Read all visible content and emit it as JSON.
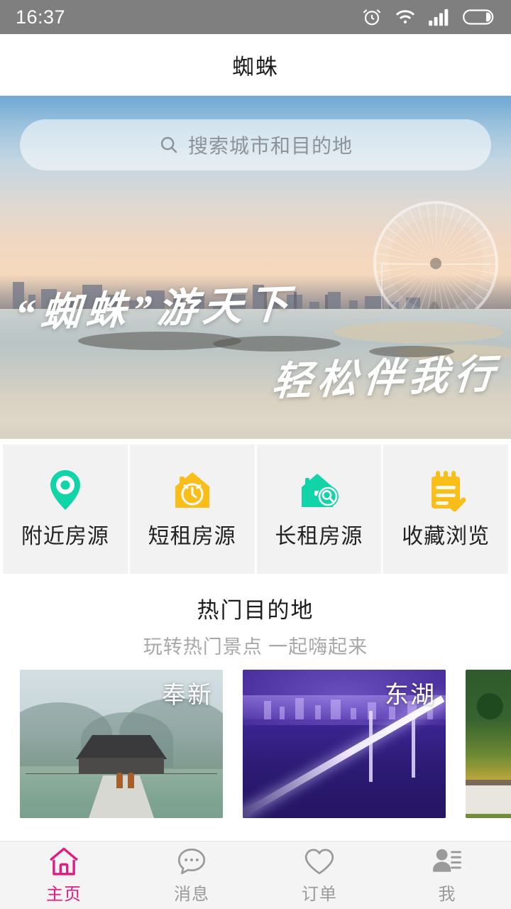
{
  "status_bar": {
    "time": "16:37",
    "icons": [
      "alarm-clock-icon",
      "wifi-icon",
      "signal-icon",
      "battery-icon"
    ]
  },
  "header": {
    "title": "蜘蛛"
  },
  "hero": {
    "search": {
      "placeholder": "搜索城市和目的地",
      "icon": "search-icon"
    },
    "slogan_line1": "“蜘蛛”游天下",
    "slogan_line2": "轻松伴我行"
  },
  "quick_actions": [
    {
      "label": "附近房源",
      "icon": "location-pin-icon",
      "color": "#11d4a8"
    },
    {
      "label": "短租房源",
      "icon": "house-clock-icon",
      "color": "#fbbe18"
    },
    {
      "label": "长租房源",
      "icon": "house-search-icon",
      "color": "#11d4a8"
    },
    {
      "label": "收藏浏览",
      "icon": "notepad-check-icon",
      "color": "#fbbe18"
    }
  ],
  "section": {
    "title": "热门目的地",
    "subtitle": "玩转热门景点 一起嗨起来"
  },
  "destinations": [
    {
      "name": "奉新"
    },
    {
      "name": "东湖"
    },
    {
      "name": ""
    }
  ],
  "tabbar": {
    "items": [
      {
        "label": "主页",
        "icon": "home-icon",
        "active": true
      },
      {
        "label": "消息",
        "icon": "chat-bubble-icon",
        "active": false
      },
      {
        "label": "订单",
        "icon": "heart-icon",
        "active": false
      },
      {
        "label": "我",
        "icon": "person-list-icon",
        "active": false
      }
    ],
    "active_color": "#e5197f",
    "inactive_color": "#9a9a9a"
  }
}
